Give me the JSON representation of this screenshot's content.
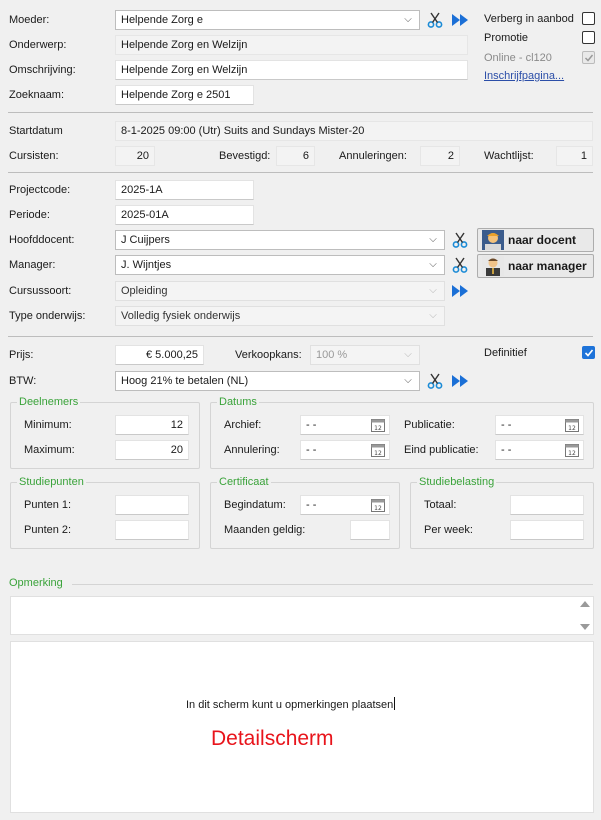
{
  "general": {
    "moeder_label": "Moeder:",
    "moeder_value": "Helpende Zorg e",
    "onderwerp_label": "Onderwerp:",
    "onderwerp_value": "Helpende Zorg en Welzijn",
    "omschrijving_label": "Omschrijving:",
    "omschrijving_value": "Helpende Zorg en Welzijn",
    "zoeknaam_label": "Zoeknaam:",
    "zoeknaam_value": "Helpende Zorg e 2501",
    "verberg_label": "Verberg in aanbod",
    "promotie_label": "Promotie",
    "online_label": "Online - cl120",
    "inschrijf_link": "Inschrijfpagina..."
  },
  "schedule": {
    "startdatum_label": "Startdatum",
    "startdatum_value": "8-1-2025 09:00 (Utr) Suits and Sundays Mister-20",
    "cursisten_label": "Cursisten:",
    "cursisten_value": "20",
    "bevestigd_label": "Bevestigd:",
    "bevestigd_value": "6",
    "annuleringen_label": "Annuleringen:",
    "annuleringen_value": "2",
    "wachtlijst_label": "Wachtlijst:",
    "wachtlijst_value": "1"
  },
  "project": {
    "projectcode_label": "Projectcode:",
    "projectcode_value": "2025-1A",
    "periode_label": "Periode:",
    "periode_value": "2025-01A",
    "hoofddocent_label": "Hoofddocent:",
    "hoofddocent_value": "J Cuijpers",
    "manager_label": "Manager:",
    "manager_value": "J. Wijntjes",
    "cursussoort_label": "Cursussoort:",
    "cursussoort_value": "Opleiding",
    "type_label": "Type onderwijs:",
    "type_value": "Volledig fysiek onderwijs",
    "naar_docent": "naar docent",
    "naar_manager": "naar manager"
  },
  "price": {
    "prijs_label": "Prijs:",
    "prijs_value": "€ 5.000,25",
    "verkoopkans_label": "Verkoopkans:",
    "verkoopkans_value": "100 %",
    "definitief_label": "Definitief",
    "btw_label": "BTW:",
    "btw_value": "Hoog 21% te betalen (NL)"
  },
  "deelnemers": {
    "title": "Deelnemers",
    "minimum_label": "Minimum:",
    "minimum_value": "12",
    "maximum_label": "Maximum:",
    "maximum_value": "20"
  },
  "datums": {
    "title": "Datums",
    "archief_label": "Archief:",
    "archief_value": "-  -",
    "annulering_label": "Annulering:",
    "annulering_value": "-  -",
    "publicatie_label": "Publicatie:",
    "publicatie_value": "-  -",
    "eind_publicatie_label": "Eind publicatie:",
    "eind_publicatie_value": "-  -",
    "calendar_day": "12"
  },
  "studiepunten": {
    "title": "Studiepunten",
    "punten1_label": "Punten 1:",
    "punten2_label": "Punten 2:"
  },
  "certificaat": {
    "title": "Certificaat",
    "begindatum_label": "Begindatum:",
    "begindatum_value": "-  -",
    "maanden_label": "Maanden geldig:"
  },
  "studiebelasting": {
    "title": "Studiebelasting",
    "totaal_label": "Totaal:",
    "perweek_label": "Per week:"
  },
  "opmerking": {
    "title": "Opmerking",
    "placeholder_text": "In dit scherm kunt u opmerkingen plaatsen",
    "detail_label": "Detailscherm"
  },
  "colors": {
    "accent_green": "#3aa33a",
    "link_blue": "#2b4ea8",
    "detail_red": "#e8141b",
    "check_blue": "#1e73d9"
  }
}
